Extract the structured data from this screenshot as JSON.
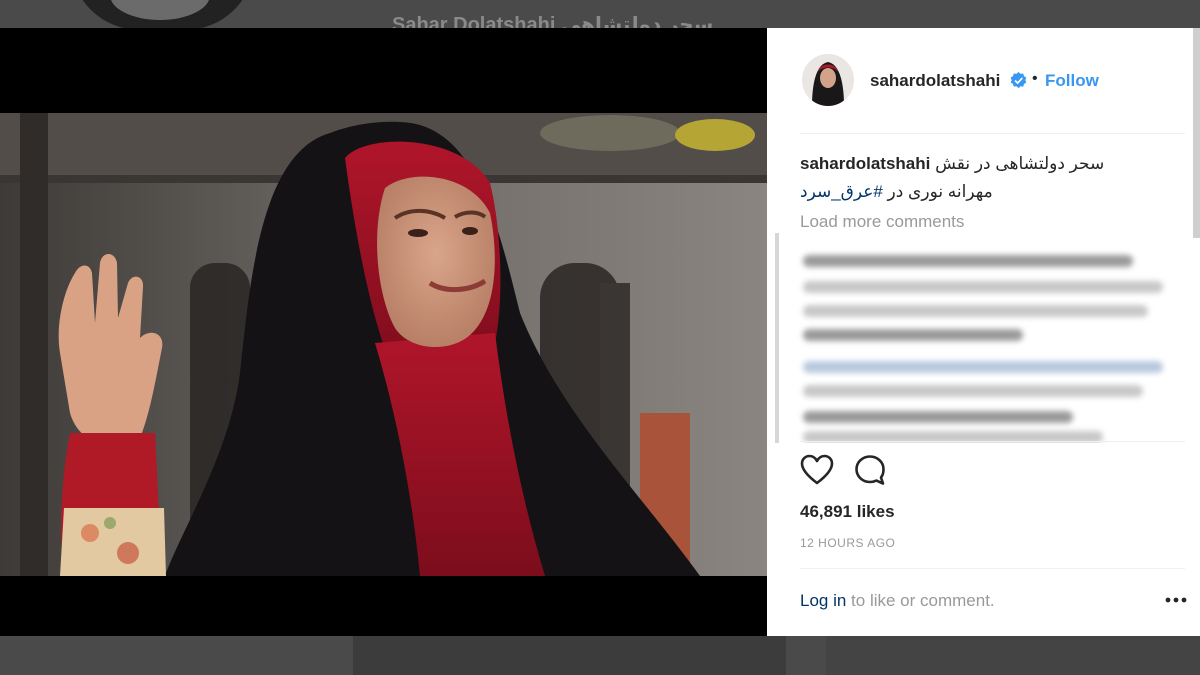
{
  "background": {
    "title": "Sahar Dolatshahi    سحر دولتشاهی"
  },
  "post": {
    "username": "sahardolatshahi",
    "verified": true,
    "separator": "•",
    "follow_label": "Follow",
    "caption": {
      "username": "sahardolatshahi",
      "line1": "سحر دولتشاهی در نقش",
      "line2_prefix": "مهرانه نوری در ",
      "hashtag": "#عرق_سرد"
    },
    "load_more_label": "Load more comments",
    "likes": "46,891 likes",
    "timestamp": "12 HOURS AGO",
    "login_link": "Log in",
    "login_suffix": " to like or comment."
  },
  "icons": {
    "like": "heart-outline-icon",
    "comment": "comment-bubble-icon",
    "verified": "verified-badge-icon",
    "more": "more-horizontal-icon"
  },
  "colors": {
    "link_blue": "#3897f0",
    "verified_blue": "#3897f0",
    "hashtag": "#003569",
    "text": "#262626",
    "muted": "#999999"
  }
}
